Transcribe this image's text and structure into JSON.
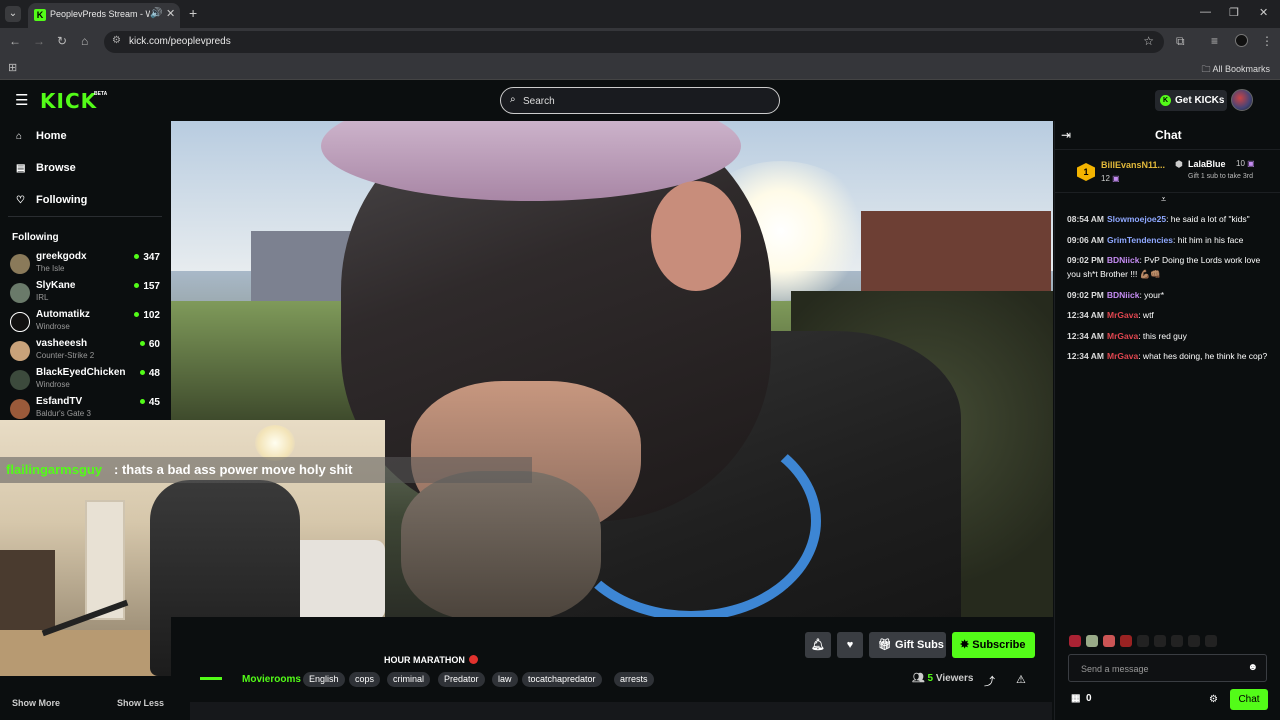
{
  "browser": {
    "tab_title": "PeoplevPreds Stream - Wat",
    "url": "kick.com/peoplevpreds",
    "all_bookmarks": "All Bookmarks"
  },
  "header": {
    "logo": "KICK",
    "beta": "BETA",
    "search_placeholder": "Search",
    "get_kicks": "Get KICKs"
  },
  "sidebar": {
    "nav": [
      {
        "label": "Home",
        "icon": "home-icon"
      },
      {
        "label": "Browse",
        "icon": "browse-icon"
      },
      {
        "label": "Following",
        "icon": "heart-icon"
      }
    ],
    "following_heading": "Following",
    "following": [
      {
        "name": "greekgodx",
        "game": "The Isle",
        "viewers": "347"
      },
      {
        "name": "SlyKane",
        "game": "IRL",
        "viewers": "157"
      },
      {
        "name": "Automatikz",
        "game": "Windrose",
        "viewers": "102"
      },
      {
        "name": "vasheeesh",
        "game": "Counter-Strike 2",
        "viewers": "60"
      },
      {
        "name": "BlackEyedChicken",
        "game": "Windrose",
        "viewers": "48"
      },
      {
        "name": "EsfandTV",
        "game": "Baldur's Gate 3",
        "viewers": "45"
      }
    ],
    "show_more": "Show More",
    "show_less": "Show Less"
  },
  "overlay_chat": {
    "user": "flailingarmsguy",
    "message": ": thats a bad ass power move holy shit"
  },
  "stream": {
    "title_fragment": "HOUR MARATHON",
    "category": "Movierooms",
    "tags": [
      "English",
      "cops",
      "criminal",
      "Predator",
      "law",
      "tocatchapredator",
      "arrests"
    ],
    "viewers_count": "5",
    "viewers_label": "Viewers",
    "gift_subs": "Gift Subs",
    "subscribe": "Subscribe"
  },
  "chat": {
    "title": "Chat",
    "gifter1": {
      "rank": "1",
      "name": "BillEvansN11...",
      "count": "12"
    },
    "gifter2": {
      "name": "LalaBlue",
      "count": "10",
      "note": "Gift 1 sub to take 3rd"
    },
    "messages": [
      {
        "time": "08:54 AM",
        "user": "Slowmoejoe25",
        "color": "#8fa8ff",
        "text": ": he said a lot of \"kids\""
      },
      {
        "time": "09:06 AM",
        "user": "GrimTendencies",
        "color": "#8fa8ff",
        "text": ": hit him in his face"
      },
      {
        "time": "09:02 PM",
        "user": "BDNiick",
        "color": "#c58cf2",
        "text": ": PvP Doing the Lords work love you sh*t Brother !!! 💪🏽👊🏽"
      },
      {
        "time": "09:02 PM",
        "user": "BDNiick",
        "color": "#c58cf2",
        "text": ": your*"
      },
      {
        "time": "12:34 AM",
        "user": "MrGava",
        "color": "#e0464f",
        "text": ": wtf"
      },
      {
        "time": "12:34 AM",
        "user": "MrGava",
        "color": "#e0464f",
        "text": ": this red guy"
      },
      {
        "time": "12:34 AM",
        "user": "MrGava",
        "color": "#e0464f",
        "text": ": what hes doing, he think he cop?"
      }
    ],
    "send_placeholder": "Send a message",
    "points": "0",
    "chat_button": "Chat"
  },
  "colors": {
    "accent": "#53fc18",
    "bg": "#0b0e0f"
  }
}
